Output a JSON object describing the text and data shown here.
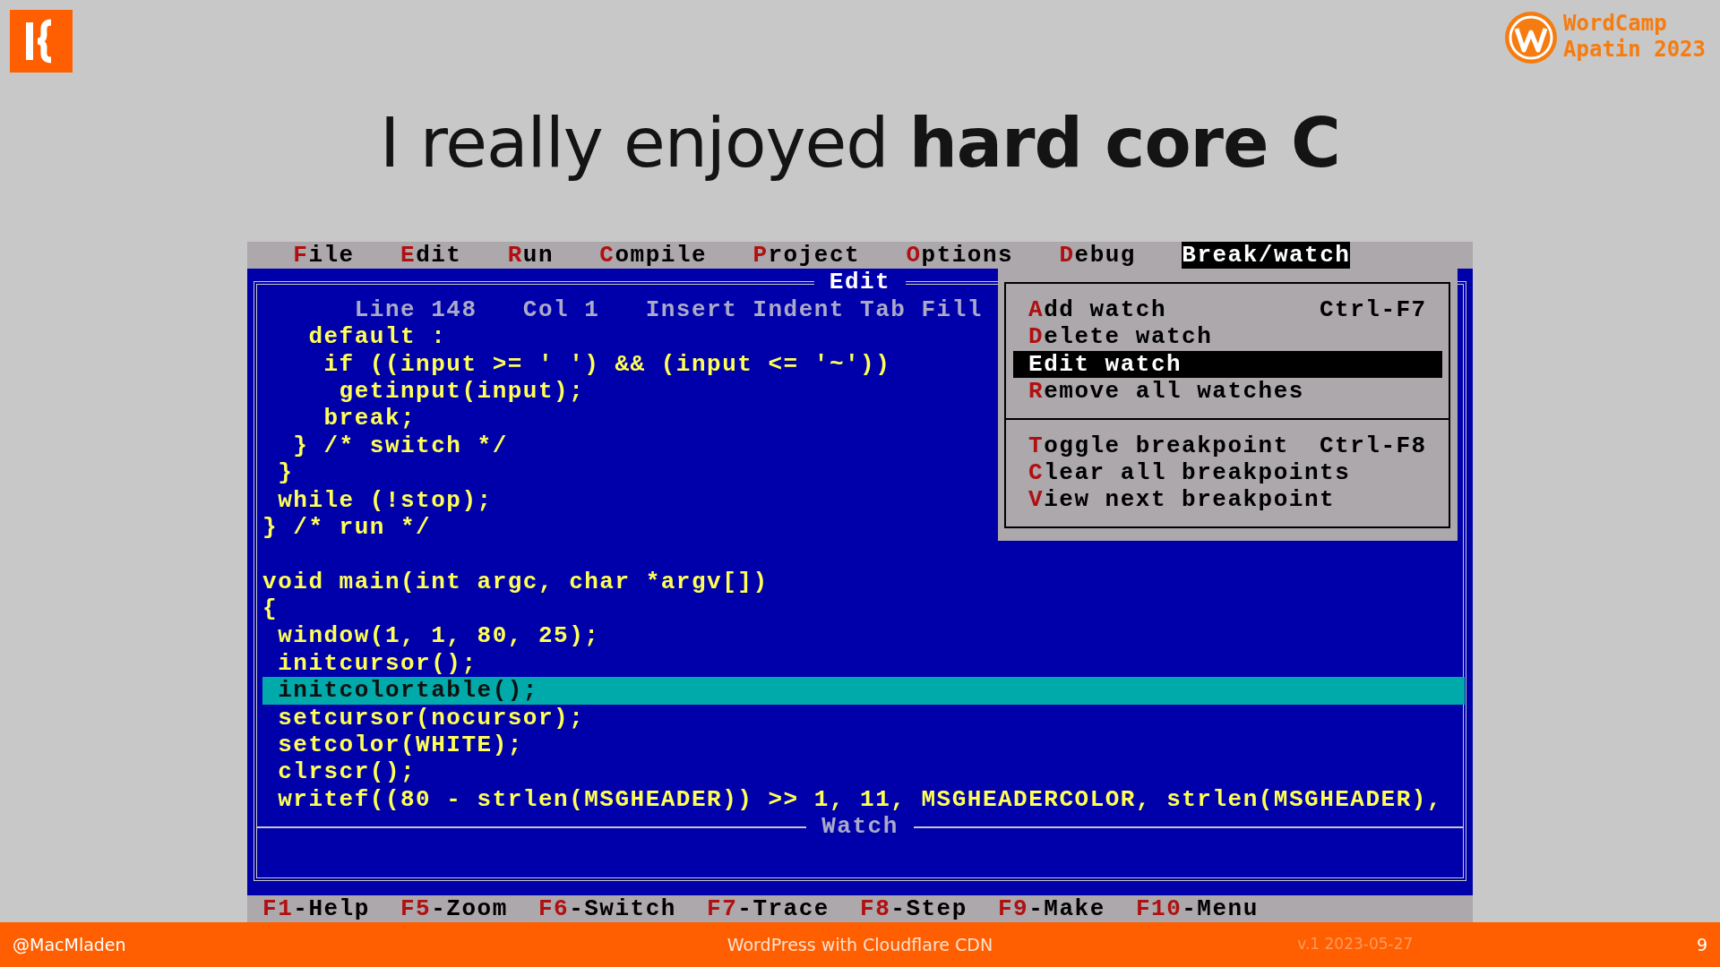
{
  "slide": {
    "title": "I really enjoyed **hard core C**",
    "event_name": "WordCamp",
    "event_place": "Apatin 2023"
  },
  "ide": {
    "menu": [
      {
        "label": "File",
        "selected": false
      },
      {
        "label": "Edit",
        "selected": false
      },
      {
        "label": "Run",
        "selected": false
      },
      {
        "label": "Compile",
        "selected": false
      },
      {
        "label": "Project",
        "selected": false
      },
      {
        "label": "Options",
        "selected": false
      },
      {
        "label": "Debug",
        "selected": false
      },
      {
        "label": "Break/watch",
        "selected": true
      }
    ],
    "edit_window": {
      "title": "Edit",
      "status": {
        "line": "Line 148",
        "column": "Col 1",
        "modes": "Insert Indent Tab Fill"
      },
      "code_blocks": [
        [
          {
            "text": "   default :",
            "highlighted": false
          },
          {
            "text": "    if ((input >= ' ') && (input <= '~'))",
            "highlighted": false
          },
          {
            "text": "     getinput(input);",
            "highlighted": false
          },
          {
            "text": "    break;",
            "highlighted": false
          },
          {
            "text": "  } /* switch */",
            "highlighted": false
          },
          {
            "text": " }",
            "highlighted": false
          },
          {
            "text": " while (!stop);",
            "highlighted": false
          },
          {
            "text": "} /* run */",
            "highlighted": false
          }
        ],
        [
          {
            "text": "void main(int argc, char *argv[])",
            "highlighted": false
          },
          {
            "text": "{",
            "highlighted": false
          },
          {
            "text": " window(1, 1, 80, 25);",
            "highlighted": false
          },
          {
            "text": " initcursor();",
            "highlighted": false
          },
          {
            "text": " initcolortable();",
            "highlighted": true
          },
          {
            "text": " setcursor(nocursor);",
            "highlighted": false
          },
          {
            "text": " setcolor(WHITE);",
            "highlighted": false
          },
          {
            "text": " clrscr();",
            "highlighted": false
          },
          {
            "text": " writef((80 - strlen(MSGHEADER)) >> 1, 11, MSGHEADERCOLOR, strlen(MSGHEADER),",
            "highlighted": false
          }
        ]
      ]
    },
    "watch_window": {
      "title": "Watch"
    },
    "dropdown": {
      "sections": [
        [
          {
            "label": "Add watch",
            "shortcut": "Ctrl-F7",
            "selected": false
          },
          {
            "label": "Delete watch",
            "selected": false
          },
          {
            "label": "Edit watch",
            "selected": true
          },
          {
            "label": "Remove all watches",
            "selected": false
          }
        ],
        [
          {
            "label": "Toggle breakpoint",
            "shortcut": "Ctrl-F8",
            "selected": false
          },
          {
            "label": "Clear all breakpoints",
            "selected": false
          },
          {
            "label": "View next breakpoint",
            "selected": false
          }
        ]
      ]
    },
    "function_keys": [
      {
        "key": "F1",
        "action": "-Help"
      },
      {
        "key": "F5",
        "action": "-Zoom"
      },
      {
        "key": "F6",
        "action": "-Switch"
      },
      {
        "key": "F7",
        "action": "-Trace"
      },
      {
        "key": "F8",
        "action": "-Step"
      },
      {
        "key": "F9",
        "action": "-Make"
      },
      {
        "key": "F10",
        "action": "-Menu"
      }
    ]
  },
  "footer": {
    "author": "@MacMladen",
    "talk": "WordPress with Cloudflare CDN",
    "version": "v.1 2023-05-27",
    "page": "9"
  }
}
